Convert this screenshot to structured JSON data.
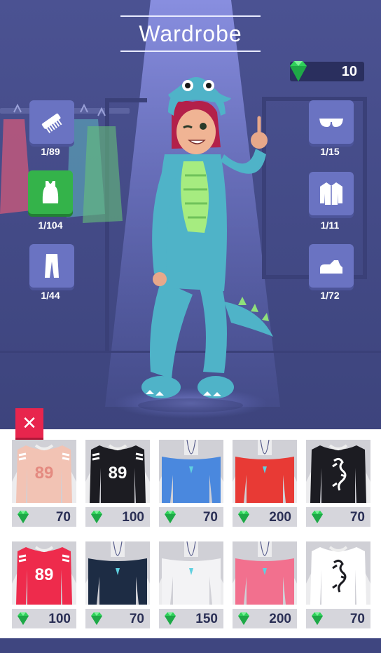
{
  "header": {
    "title": "Wardrobe"
  },
  "currency": {
    "gems": "10",
    "icon": "gem-icon",
    "color": "#2fd15a"
  },
  "categories": {
    "left": [
      {
        "name": "hair",
        "icon": "comb-icon",
        "count": "1/89",
        "active": false
      },
      {
        "name": "tops",
        "icon": "tank-top-icon",
        "count": "1/104",
        "active": true
      },
      {
        "name": "pants",
        "icon": "pants-icon",
        "count": "1/44",
        "active": false
      }
    ],
    "right": [
      {
        "name": "glasses",
        "icon": "sunglasses-icon",
        "count": "1/15",
        "active": false
      },
      {
        "name": "jackets",
        "icon": "jacket-icon",
        "count": "1/11",
        "active": false
      },
      {
        "name": "shoes",
        "icon": "sneaker-icon",
        "count": "1/72",
        "active": false
      }
    ]
  },
  "close_button": {
    "label": "✕"
  },
  "items": [
    {
      "name": "peach-jersey-89",
      "price": "70",
      "color": "#f2c3b4",
      "print": "89"
    },
    {
      "name": "black-jersey-89",
      "price": "100",
      "color": "#1c1c22",
      "print": "89"
    },
    {
      "name": "blue-offshoulder-pendant",
      "price": "70",
      "color": "#4a88de",
      "print": ""
    },
    {
      "name": "red-offshoulder-pendant",
      "price": "200",
      "color": "#e83a35",
      "print": ""
    },
    {
      "name": "black-dragon-tee",
      "price": "70",
      "color": "#1c1c22",
      "print": "dragon"
    },
    {
      "name": "red-jersey-89",
      "price": "100",
      "color": "#ee2b4c",
      "print": "89"
    },
    {
      "name": "navy-offshoulder-pendant",
      "price": "70",
      "color": "#1d2c44",
      "print": ""
    },
    {
      "name": "white-offshoulder-pendant",
      "price": "150",
      "color": "#f3f3f5",
      "print": ""
    },
    {
      "name": "pink-offshoulder-pendant",
      "price": "200",
      "color": "#f2708e",
      "print": ""
    },
    {
      "name": "white-dragon-tee",
      "price": "70",
      "color": "#ffffff",
      "print": "dragon"
    }
  ]
}
